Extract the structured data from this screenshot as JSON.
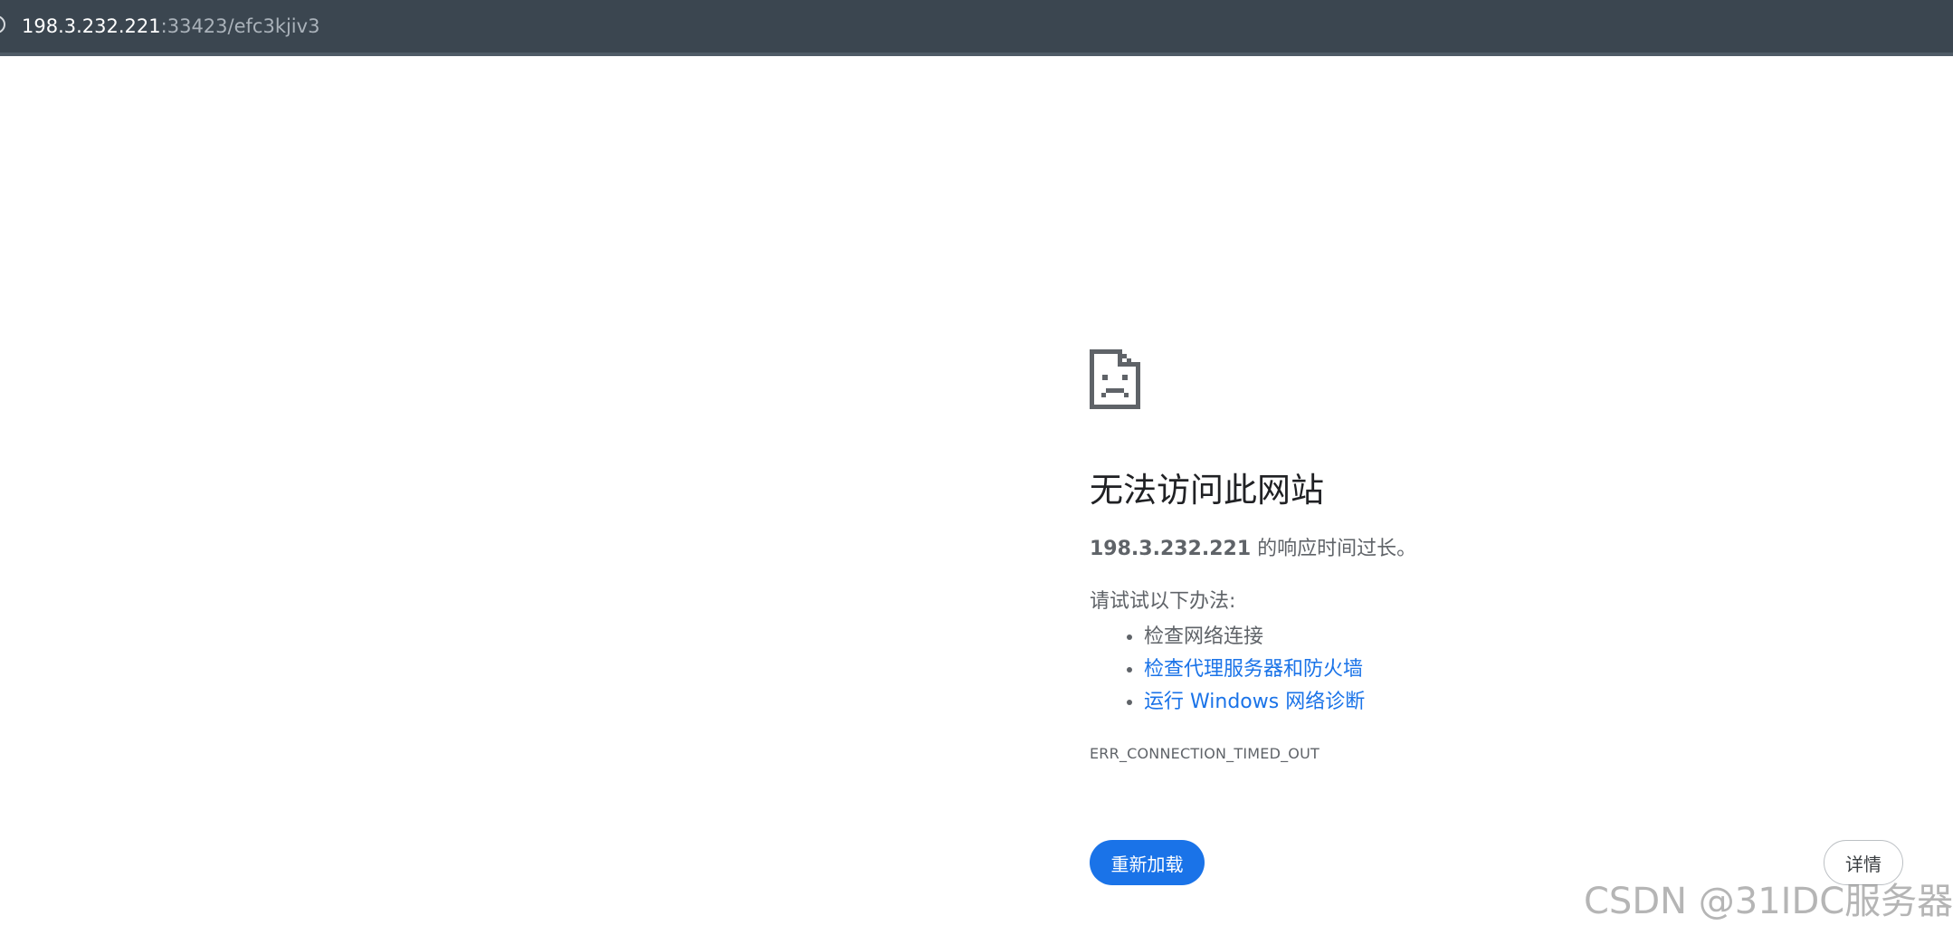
{
  "address_bar": {
    "url_host": "198.3.232.221",
    "url_path": ":33423/efc3kjiv3",
    "icon": "info-icon"
  },
  "error_page": {
    "icon": "sad-page-icon",
    "headline": "无法访问此网站",
    "summary_host": "198.3.232.221",
    "summary_rest": " 的响应时间过长。",
    "try_label": "请试试以下办法:",
    "suggestions": [
      {
        "label": "检查网络连接",
        "link": false
      },
      {
        "label": "检查代理服务器和防火墙",
        "link": true
      },
      {
        "label": "运行 Windows 网络诊断",
        "link": true
      }
    ],
    "error_code": "ERR_CONNECTION_TIMED_OUT",
    "reload_label": "重新加载",
    "details_label": "详情"
  },
  "watermark": "CSDN @31IDC服务器",
  "colors": {
    "address_bar_bg": "#3b4650",
    "link": "#1a73e8",
    "button_primary": "#1a73e8",
    "text": "#5f6368",
    "headline": "#202124"
  }
}
